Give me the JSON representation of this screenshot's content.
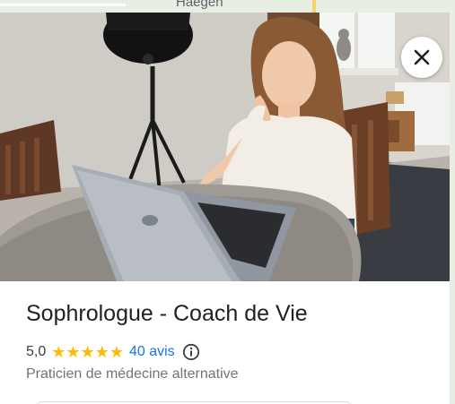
{
  "map": {
    "label": "Haegen"
  },
  "place": {
    "title": "Sophrologue - Coach de Vie",
    "rating": "5,0",
    "stars": 5,
    "reviews_label": "40 avis",
    "category": "Praticien de médecine alternative"
  },
  "colors": {
    "star": "#fbbc04",
    "link": "#1a73e8",
    "title": "#202124",
    "secondary": "#70757a"
  },
  "icons": {
    "close": "close-icon",
    "info": "info-icon",
    "star": "star-icon"
  }
}
